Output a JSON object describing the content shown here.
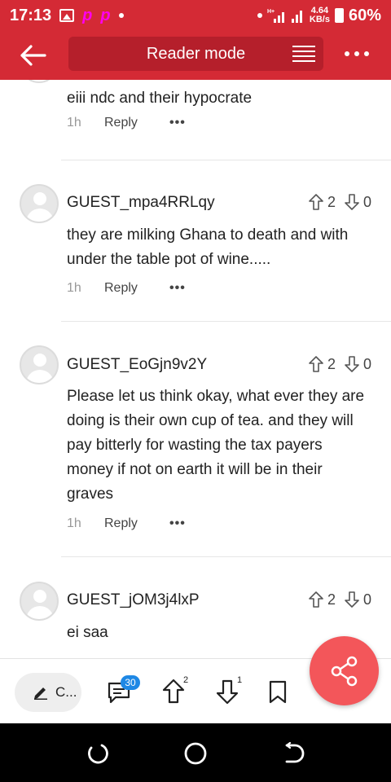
{
  "status_bar": {
    "time": "17:13",
    "net_speed_value": "4.64",
    "net_speed_unit": "KB/s",
    "battery": "60%",
    "network_label": "H+"
  },
  "header": {
    "title": "Reader mode"
  },
  "comments": [
    {
      "text": "eiii ndc and their hypocrate",
      "time": "1h",
      "reply": "Reply"
    },
    {
      "username": "GUEST_mpa4RRLqy",
      "up": "2",
      "down": "0",
      "text": "they are milking Ghana to death and with under the table pot of wine.....",
      "time": "1h",
      "reply": "Reply"
    },
    {
      "username": "GUEST_EoGjn9v2Y",
      "up": "2",
      "down": "0",
      "text": "Please let us think okay, what ever they are doing is their own cup of tea. and they will pay bitterly for wasting the tax payers money if not on earth it will be in their graves",
      "time": "1h",
      "reply": "Reply"
    },
    {
      "username": "GUEST_jOM3j4lxP",
      "up": "2",
      "down": "0",
      "text": "ei  saa"
    }
  ],
  "bottom_bar": {
    "comment_placeholder": "C...",
    "comments_count": "30",
    "upvotes": "2",
    "downvotes": "1"
  },
  "colors": {
    "brand_red": "#d42a35",
    "header_pill": "#b51f2b",
    "share_fab": "#f3565a",
    "badge_blue": "#1e88e5"
  },
  "icons": [
    "back-arrow-icon",
    "menu-lines-icon",
    "more-icon",
    "upvote-icon",
    "downvote-icon",
    "comment-icon",
    "bookmark-icon",
    "share-icon",
    "pencil-icon"
  ]
}
